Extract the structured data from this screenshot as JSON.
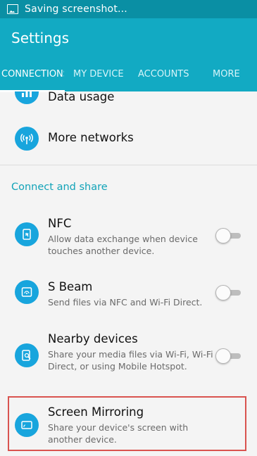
{
  "status_bar": {
    "notification_text": "Saving screenshot..."
  },
  "app_bar": {
    "title": "Settings"
  },
  "tabs": [
    {
      "label": "CONNECTIONS",
      "active": true
    },
    {
      "label": "MY DEVICE",
      "active": false
    },
    {
      "label": "ACCOUNTS",
      "active": false
    },
    {
      "label": "MORE",
      "active": false
    }
  ],
  "items": {
    "data_usage": {
      "title": "Data usage",
      "icon": "bar-chart-icon"
    },
    "more_networks": {
      "title": "More networks",
      "icon": "signal-tower-icon"
    }
  },
  "section": {
    "header": "Connect and share"
  },
  "share_items": [
    {
      "title": "NFC",
      "subtitle": "Allow data exchange when device touches another device.",
      "icon": "nfc-icon",
      "toggle": false
    },
    {
      "title": "S Beam",
      "subtitle": "Send files via NFC and Wi-Fi Direct.",
      "icon": "s-beam-icon",
      "toggle": false
    },
    {
      "title": "Nearby devices",
      "subtitle": "Share your media files via Wi-Fi, Wi-Fi Direct, or using Mobile Hotspot.",
      "icon": "nearby-devices-icon",
      "toggle": false
    },
    {
      "title": "Screen Mirroring",
      "subtitle": "Share your device's screen with another device.",
      "icon": "screen-mirroring-icon",
      "highlighted": true
    }
  ],
  "colors": {
    "status_bar": "#0a8fa4",
    "app_bar": "#12aac3",
    "accent": "#12a3b8",
    "icon_bg": "#18a5dd",
    "highlight_border": "#d9534f"
  }
}
